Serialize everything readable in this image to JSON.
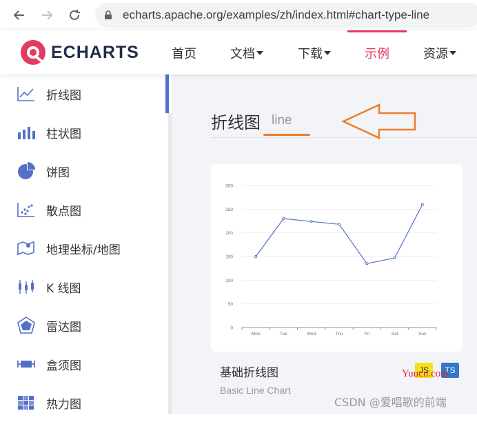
{
  "browser": {
    "url": "echarts.apache.org/examples/zh/index.html#chart-type-line"
  },
  "header": {
    "logo_text": "ECHARTS",
    "nav": [
      {
        "label": "首页",
        "dropdown": false,
        "active": false
      },
      {
        "label": "文档",
        "dropdown": true,
        "active": false
      },
      {
        "label": "下载",
        "dropdown": true,
        "active": false
      },
      {
        "label": "示例",
        "dropdown": false,
        "active": true
      },
      {
        "label": "资源",
        "dropdown": true,
        "active": false
      }
    ],
    "accent_color": "#e43961"
  },
  "sidebar": {
    "items": [
      {
        "label": "折线图",
        "icon": "line-chart-icon",
        "selected": true
      },
      {
        "label": "柱状图",
        "icon": "bar-chart-icon",
        "selected": false
      },
      {
        "label": "饼图",
        "icon": "pie-chart-icon",
        "selected": false
      },
      {
        "label": "散点图",
        "icon": "scatter-chart-icon",
        "selected": false
      },
      {
        "label": "地理坐标/地图",
        "icon": "map-icon",
        "selected": false
      },
      {
        "label": "K 线图",
        "icon": "candlestick-icon",
        "selected": false
      },
      {
        "label": "雷达图",
        "icon": "radar-chart-icon",
        "selected": false
      },
      {
        "label": "盒须图",
        "icon": "boxplot-icon",
        "selected": false
      },
      {
        "label": "热力图",
        "icon": "heatmap-icon",
        "selected": false
      }
    ],
    "icon_color": "#5470c6"
  },
  "main": {
    "section_title": "折线图",
    "section_subtitle": "line",
    "example": {
      "title": "基础折线图",
      "subtitle": "Basic Line Chart",
      "badge_js": "JS",
      "badge_ts": "TS"
    }
  },
  "chart_data": {
    "type": "line",
    "categories": [
      "Mon",
      "Tue",
      "Wed",
      "Thu",
      "Fri",
      "Sat",
      "Sun"
    ],
    "values": [
      150,
      230,
      224,
      218,
      135,
      147,
      260
    ],
    "ylim": [
      0,
      300
    ],
    "yticks": [
      "0",
      "50",
      "100",
      "150",
      "200",
      "250",
      "300"
    ],
    "grid": true,
    "line_color": "#5470c6"
  },
  "watermarks": {
    "yuucn": "Yuucn.com",
    "csdn": "CSDN @爱唱歌的前端"
  }
}
